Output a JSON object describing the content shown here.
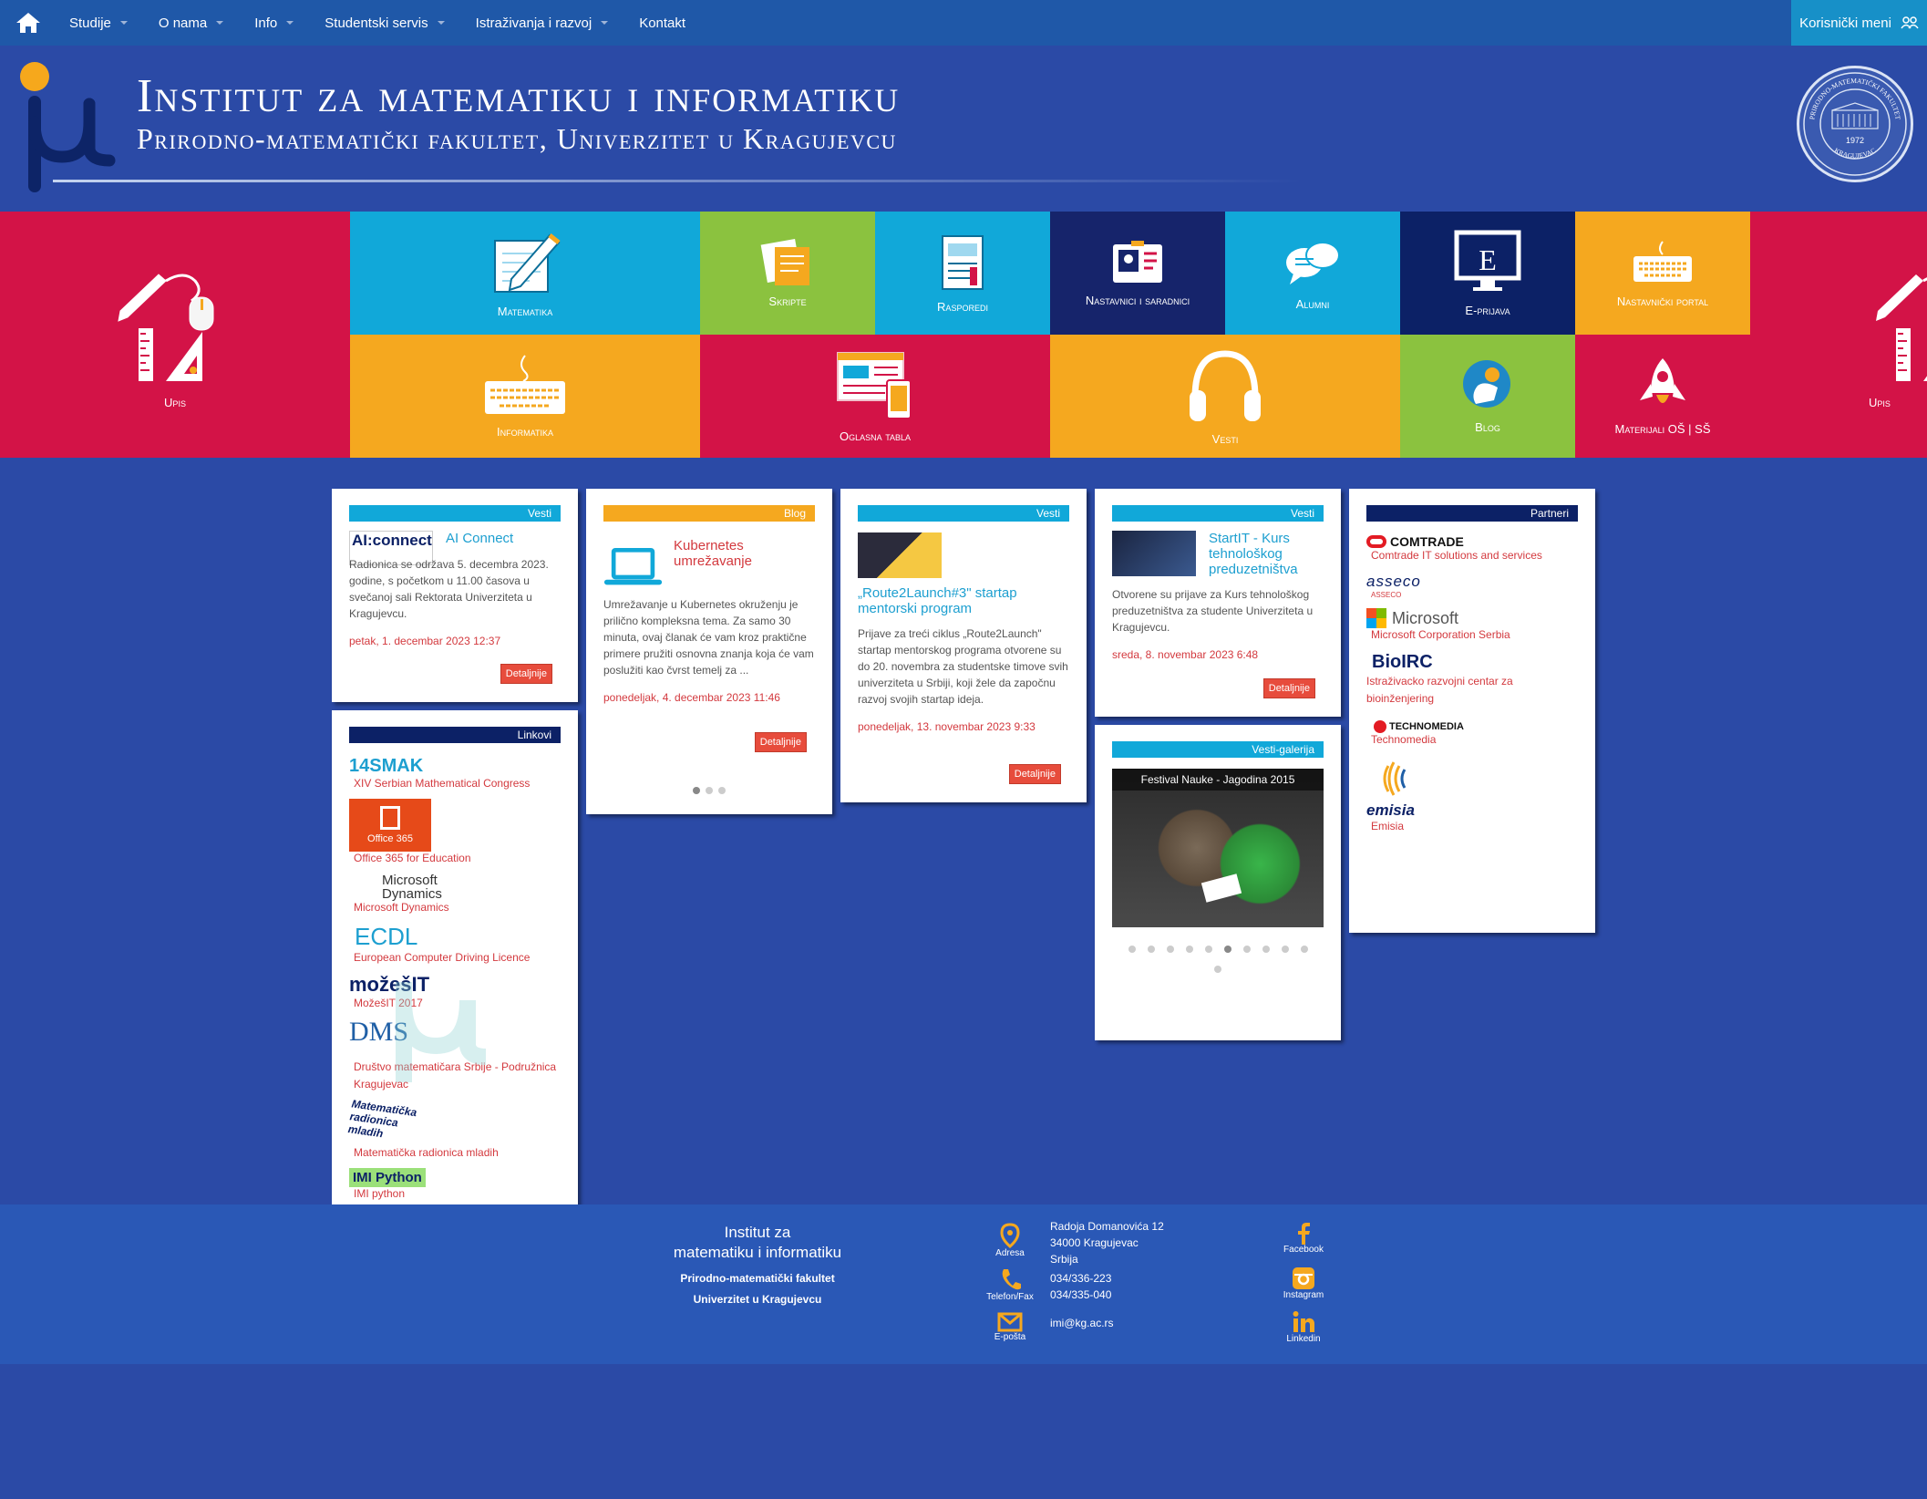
{
  "nav": {
    "home_icon": "home-icon",
    "items": [
      "Studije",
      "O nama",
      "Info",
      "Studentski servis",
      "Istraživanja i razvoj",
      "Kontakt"
    ],
    "user_menu": "Korisnički meni",
    "user_menu_icon": "users-icon"
  },
  "header": {
    "title": "Institut za matematiku i informatiku",
    "subtitle": "Prirodno-matematički fakultet, Univerzitet u Kragujevcu",
    "seal_year": "1972",
    "seal_top": "PRIRODNO-MATEMATIČKI FAKULTET",
    "seal_bottom": "KRAGUJEVAC"
  },
  "tiles": {
    "upis": "Upis",
    "matematika": "Matematika",
    "skripte": "Skripte",
    "rasporedi": "Rasporedi",
    "nastavnici": "Nastavnici i saradnici",
    "alumni": "Alumni",
    "eprijava": "E-prijava",
    "nastavnicki_portal": "Nastavnički portal",
    "informatika": "Informatika",
    "oglasna_tabla": "Oglasna tabla",
    "vesti": "Vesti",
    "blog": "Blog",
    "materijali": "Materijali OŠ | SŠ",
    "upis_right": "Upis",
    "colors": {
      "red": "#d31347",
      "cyan": "#11a8d9",
      "green": "#8bc23f",
      "navy": "#16246b",
      "orange": "#f5a81f",
      "deepnavy": "#0c2166"
    }
  },
  "cards": {
    "vesti1": {
      "bar": "Vesti",
      "logo_text": "AI:connect",
      "title": "AI Connect",
      "body": "Radionica se održava 5. decembra 2023. godine, s početkom u 11.00 časova u svečanoj sali Rektorata Univerziteta u Kragujevcu.",
      "date": "petak, 1. decembar 2023 12:37",
      "button": "Detaljnije"
    },
    "blog": {
      "bar": "Blog",
      "title": "Kubernetes umrežavanje",
      "body": "Umrežavanje u Kubernetes okruženju je prilično kompleksna tema. Za samo 30 minuta, ovaj članak će vam kroz praktične primere pružiti osnovna znanja koja će vam poslužiti kao čvrst temelj za ...",
      "date": "ponedeljak, 4. decembar 2023 11:46",
      "button": "Detaljnije"
    },
    "vesti2": {
      "bar": "Vesti",
      "title": "„Route2Launch#3\" startap mentorski program",
      "body": "Prijave za treći ciklus „Route2Launch\" startap mentorskog programa otvorene su do 20. novembra za studentske timove svih univerziteta u Srbiji, koji žele da započnu razvoj svojih startap ideja.",
      "date": "ponedeljak, 13. novembar 2023 9:33",
      "button": "Detaljnije"
    },
    "vesti3": {
      "bar": "Vesti",
      "title": "StartIT - Kurs tehnološkog preduzetništva",
      "body": "Otvorene su prijave za Kurs tehnološkog preduzetništva za studente Univerziteta u Kragujevcu.",
      "date": "sreda, 8. novembar 2023 6:48",
      "button": "Detaljnije"
    },
    "galerija": {
      "bar": "Vesti-galerija",
      "caption": "Festival Nauke - Jagodina 2015"
    },
    "linkovi": {
      "bar": "Linkovi",
      "items": [
        {
          "logo": "14SMAK",
          "label": "XIV Serbian Mathematical Congress"
        },
        {
          "logo": "Office 365",
          "label": "Office 365 for Education"
        },
        {
          "logo": "Microsoft Dynamics",
          "label": "Microsoft Dynamics"
        },
        {
          "logo": "ECDL",
          "label": "European Computer Driving Licence"
        },
        {
          "logo": "možešIT",
          "label": "MožešIT 2017"
        },
        {
          "logo": "DMS",
          "label": "Društvo matematičara Srbije - Podružnica Kragujevac"
        },
        {
          "logo": "Matematička radionica mladih",
          "label": "Matematička radionica mladih"
        },
        {
          "logo": "IMI Python",
          "label": "IMI python"
        }
      ]
    },
    "partneri": {
      "bar": "Partneri",
      "items": [
        {
          "logo": "COMTRADE",
          "label": "Comtrade IT solutions and services"
        },
        {
          "logo": "asseco",
          "label": "ASSECO"
        },
        {
          "logo": "Microsoft",
          "label": "Microsoft Corporation Serbia"
        },
        {
          "logo": "BioIRC",
          "label": "Istraživacko razvojni centar za bioinženjering"
        },
        {
          "logo": "TECHNOMEDIA",
          "label": "Technomedia"
        },
        {
          "logo": "emisia",
          "label": "Emisia"
        }
      ]
    }
  },
  "footer": {
    "name1": "Institut za",
    "name2": "matematiku i informatiku",
    "fac1": "Prirodno-matematički fakultet",
    "fac2": "Univerzitet u Kragujevcu",
    "address_label": "Adresa",
    "address1": "Radoja Domanovića 12",
    "address2": "34000 Kragujevac",
    "address3": "Srbija",
    "phone_label": "Telefon/Fax",
    "phone1": "034/336-223",
    "phone2": "034/335-040",
    "email_label": "E-pošta",
    "email": "imi@kg.ac.rs",
    "facebook": "Facebook",
    "instagram": "Instagram",
    "linkedin": "Linkedin"
  }
}
